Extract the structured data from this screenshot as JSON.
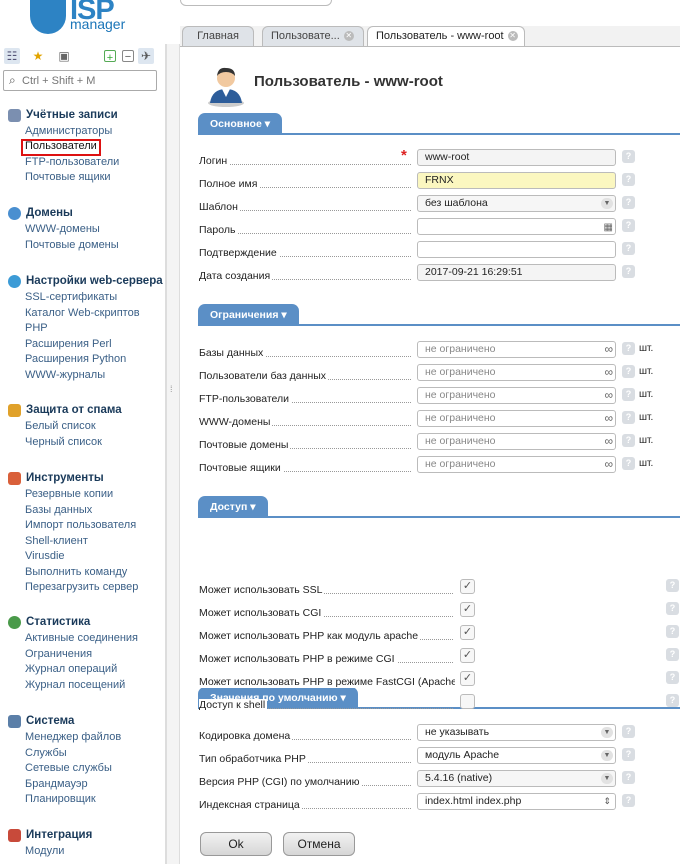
{
  "logo": {
    "text": "ISP",
    "sub": "manager"
  },
  "sidebar": {
    "search_placeholder": "Ctrl + Shift + M",
    "sections": [
      {
        "title": "Учётные записи",
        "icon": "users-icon",
        "items": [
          "Администраторы",
          "Пользователи",
          "FTP-пользователи",
          "Почтовые ящики"
        ]
      },
      {
        "title": "Домены",
        "icon": "globe-icon",
        "items": [
          "WWW-домены",
          "Почтовые домены"
        ]
      },
      {
        "title": "Настройки web-сервера",
        "icon": "web-server-icon",
        "items": [
          "SSL-сертификаты",
          "Каталог Web-скриптов",
          "PHP",
          "Расширения Perl",
          "Расширения Python",
          "WWW-журналы"
        ]
      },
      {
        "title": "Защита от спама",
        "icon": "shield-icon",
        "items": [
          "Белый список",
          "Черный список"
        ]
      },
      {
        "title": "Инструменты",
        "icon": "tools-icon",
        "items": [
          "Резервные копии",
          "Базы данных",
          "Импорт пользователя",
          "Shell-клиент",
          "Virusdie",
          "Выполнить команду",
          "Перезагрузить сервер"
        ]
      },
      {
        "title": "Статистика",
        "icon": "chart-icon",
        "items": [
          "Активные соединения",
          "Ограничения",
          "Журнал операций",
          "Журнал посещений"
        ]
      },
      {
        "title": "Система",
        "icon": "system-icon",
        "items": [
          "Менеджер файлов",
          "Службы",
          "Сетевые службы",
          "Брандмауэр",
          "Планировщик"
        ]
      },
      {
        "title": "Интеграция",
        "icon": "integration-icon",
        "items": [
          "Модули"
        ]
      }
    ]
  },
  "tabs": [
    {
      "label": "Главная"
    },
    {
      "label": "Пользовате..."
    },
    {
      "label": "Пользователь - www-root"
    }
  ],
  "page": {
    "title": "Пользователь - www-root"
  },
  "groups": {
    "basic": "Основное",
    "limits": "Ограничения",
    "access": "Доступ",
    "defaults": "Значения по умолчанию"
  },
  "basic": {
    "login_label": "Логин",
    "login": "www-root",
    "fullname_label": "Полное имя",
    "fullname": "FRNX",
    "template_label": "Шаблон",
    "template": "без шаблона",
    "password_label": "Пароль",
    "confirm_label": "Подтверждение",
    "created_label": "Дата создания",
    "created": "2017-09-21 16:29:51"
  },
  "limits": {
    "placeholder": "не ограничено",
    "unit": "шт.",
    "rows": [
      "Базы данных",
      "Пользователи баз данных",
      "FTP-пользователи",
      "WWW-домены",
      "Почтовые домены",
      "Почтовые ящики"
    ]
  },
  "access": {
    "rows": [
      {
        "label": "Может использовать SSL",
        "checked": true
      },
      {
        "label": "Может использовать CGI",
        "checked": true
      },
      {
        "label": "Может использовать PHP как модуль apache",
        "checked": true
      },
      {
        "label": "Может использовать PHP в режиме CGI",
        "checked": true
      },
      {
        "label": "Может использовать PHP в режиме FastCGI (Apache)",
        "checked": true
      },
      {
        "label": "Доступ к shell",
        "checked": false
      }
    ]
  },
  "defaults": {
    "encoding_label": "Кодировка домена",
    "encoding": "не указывать",
    "handler_label": "Тип обработчика PHP",
    "handler": "модуль Apache",
    "phpver_label": "Версия PHP (CGI) по умолчанию",
    "phpver": "5.4.16 (native)",
    "index_label": "Индексная страница",
    "index": "index.html index.php"
  },
  "buttons": {
    "ok": "Ok",
    "cancel": "Отмена"
  },
  "colors": {
    "accent": "#5b8fc6",
    "brand": "#2d83c4",
    "highlight": "#d11111"
  }
}
